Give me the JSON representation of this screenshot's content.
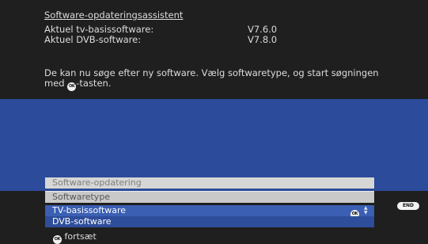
{
  "header": {
    "title": "Software-opdateringsassistent",
    "rows": [
      {
        "label": "Aktuel tv-basissoftware:",
        "value": "V7.6.0"
      },
      {
        "label": "Aktuel DVB-software:",
        "value": "V7.8.0"
      }
    ]
  },
  "message": {
    "text_before": "De kan nu søge efter ny software. Vælg softwaretype, og start søgningen med ",
    "text_after": "-tasten."
  },
  "icons": {
    "ok_label": "OK",
    "end_label": "END"
  },
  "menu": {
    "heading": "Software-opdatering",
    "field_label": "Softwaretype",
    "selected_option": "TV-basissoftware",
    "other_option": "DVB-software"
  },
  "footer": {
    "hint": "fortsæt"
  },
  "colors": {
    "background": "#1f1f1f",
    "panel_blue": "#2d4b9b",
    "selected_blue": "#3a5fb3"
  }
}
